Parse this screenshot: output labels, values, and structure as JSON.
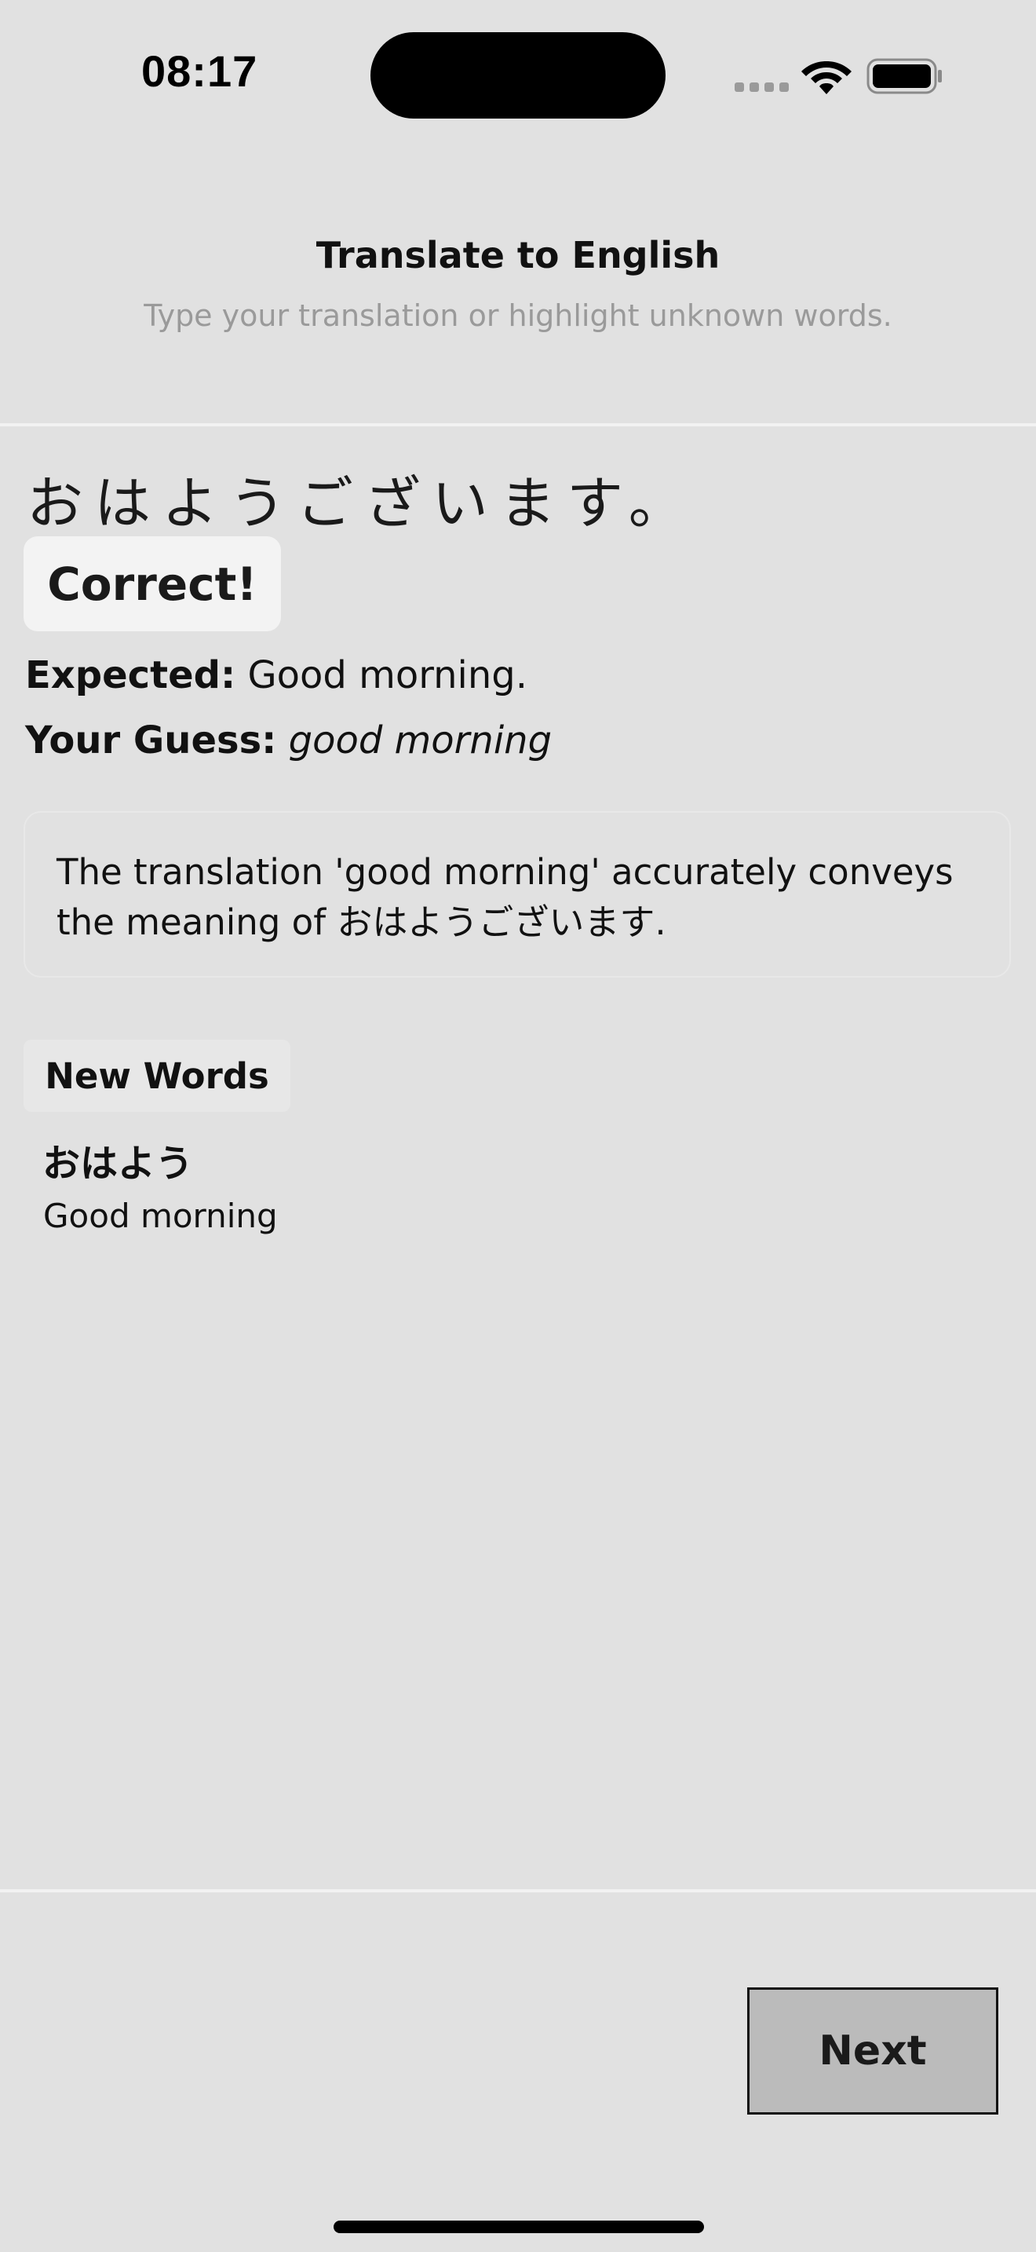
{
  "status_bar": {
    "time": "08:17"
  },
  "header": {
    "title": "Translate to English",
    "subtitle": "Type your translation or highlight unknown words."
  },
  "exercise": {
    "source_text": "おはようございます。",
    "result_label": "Correct!",
    "expected_label": "Expected:",
    "expected_value": "Good morning.",
    "guess_label": "Your Guess:",
    "guess_value": "good morning",
    "explanation": "The translation 'good morning' accurately conveys the meaning of おはようございます."
  },
  "new_words": {
    "heading": "New Words",
    "items": [
      {
        "term": "おはよう",
        "meaning": "Good morning"
      }
    ]
  },
  "footer": {
    "next_label": "Next"
  },
  "colors": {
    "background": "#e1e1e1",
    "badge_background": "#f3f3f3",
    "next_button_background": "#bbbbbb",
    "subtitle_text": "#9a9a9a"
  },
  "icons": [
    "cellular-signal-icon",
    "wifi-icon",
    "battery-icon"
  ]
}
